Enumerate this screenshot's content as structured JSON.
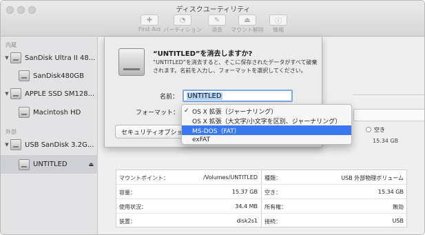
{
  "window": {
    "title": "ディスクユーティリティ"
  },
  "toolbar": {
    "items": [
      {
        "label": "First Aid",
        "icon": "first-aid-icon",
        "glyph": "✚"
      },
      {
        "label": "パーティション",
        "icon": "partition-icon",
        "glyph": "◔"
      },
      {
        "label": "消去",
        "icon": "erase-icon",
        "glyph": "✎"
      },
      {
        "label": "マウント解除",
        "icon": "unmount-icon",
        "glyph": "⏏"
      },
      {
        "label": "情報",
        "icon": "info-icon",
        "glyph": "ⓘ"
      }
    ]
  },
  "sidebar": {
    "internal_header": "内蔵",
    "external_header": "外部",
    "items": [
      {
        "label": "SanDisk Ultra II 48..."
      },
      {
        "label": "SanDisk480GB"
      },
      {
        "label": "APPLE SSD SM128..."
      },
      {
        "label": "Macintosh HD"
      },
      {
        "label": "USB SanDisk 3.2G..."
      },
      {
        "label": "UNTITLED"
      }
    ],
    "eject_glyph": "⏏"
  },
  "sheet": {
    "title": "“UNTITLED”を消去しますか?",
    "description": "“UNTITLED”を消去すると、そこに保存されたデータがすべて破棄されます。名前を入力し、フォーマットを選択してください。",
    "name_label": "名前：",
    "name_value": "UNTITLED",
    "format_label": "フォーマット：",
    "security_button": "セキュリティオプション..."
  },
  "format_menu": {
    "options": [
      {
        "label": "OS X 拡張（ジャーナリング）",
        "checked": true,
        "highlighted": false
      },
      {
        "label": "OS X 拡張（大文字/小文字を区別、ジャーナリング）",
        "checked": false,
        "highlighted": false
      },
      {
        "label": "MS-DOS（FAT）",
        "checked": false,
        "highlighted": true
      },
      {
        "label": "exFAT",
        "checked": false,
        "highlighted": false
      }
    ],
    "check_glyph": "✓",
    "highlight_color": "#3a78f0"
  },
  "usage": {
    "free_label": "空き",
    "free_value": "15.34 GB"
  },
  "info": {
    "left": [
      {
        "label": "マウントポイント：",
        "value": "/Volumes/UNTITLED"
      },
      {
        "label": "容量：",
        "value": "15.37 GB"
      },
      {
        "label": "使用状況：",
        "value": "34.4 MB"
      },
      {
        "label": "装置：",
        "value": "disk2s1"
      }
    ],
    "right": [
      {
        "label": "種類：",
        "value": "USB 外部物理ボリューム"
      },
      {
        "label": "空き：",
        "value": "15.34 GB"
      },
      {
        "label": "所有権：",
        "value": "無効"
      },
      {
        "label": "接続：",
        "value": "USB"
      }
    ]
  }
}
